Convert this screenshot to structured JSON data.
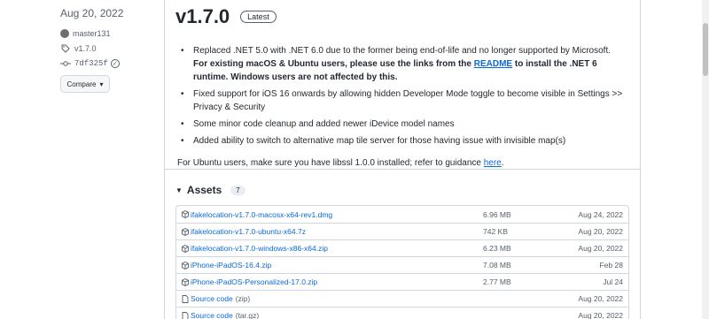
{
  "release": {
    "date": "Aug 20, 2022",
    "author": "master131",
    "tag": "v1.7.0",
    "commit": "7df325f",
    "compare_label": "Compare",
    "version": "v1.7.0",
    "latest_label": "Latest"
  },
  "notes": {
    "item1_line1": "Replaced .NET 5.0 with .NET 6.0 due to the former being end-of-life and no longer supported by Microsoft.",
    "item1_bold_pre": "For existing macOS & Ubuntu users, please use the links from the ",
    "item1_link": "README",
    "item1_bold_post": " to install the .NET 6 runtime. Windows users are not affected by this.",
    "item2": "Fixed support for iOS 16 onwards by allowing hidden Developer Mode toggle to become visible in Settings >> Privacy & Security",
    "item3": "Some minor code cleanup and added newer iDevice model names",
    "item4": "Added ability to switch to alternative map tile server for those having issue with invisible map(s)",
    "footnote_pre": "For Ubuntu users, make sure you have libssl 1.0.0 installed; refer to guidance ",
    "footnote_link": "here",
    "footnote_post": "."
  },
  "assets": {
    "heading": "Assets",
    "count": "7",
    "rows": [
      {
        "name": "ifakelocation-v1.7.0-macosx-x64-rev1.dmg",
        "suffix": "",
        "size": "6.96 MB",
        "date": "Aug 24, 2022"
      },
      {
        "name": "ifakelocation-v1.7.0-ubuntu-x64.7z",
        "suffix": "",
        "size": "742 KB",
        "date": "Aug 20, 2022"
      },
      {
        "name": "ifakelocation-v1.7.0-windows-x86-x64.zip",
        "suffix": "",
        "size": "6.23 MB",
        "date": "Aug 20, 2022"
      },
      {
        "name": "iPhone-iPadOS-16.4.zip",
        "suffix": "",
        "size": "7.08 MB",
        "date": "Feb 28"
      },
      {
        "name": "iPhone-iPadOS-Personalized-17.0.zip",
        "suffix": "",
        "size": "2.77 MB",
        "date": "Jul 24"
      },
      {
        "name": "Source code",
        "suffix": "(zip)",
        "size": "",
        "date": "Aug 20, 2022"
      },
      {
        "name": "Source code",
        "suffix": "(tar.gz)",
        "size": "",
        "date": "Aug 20, 2022"
      }
    ]
  }
}
